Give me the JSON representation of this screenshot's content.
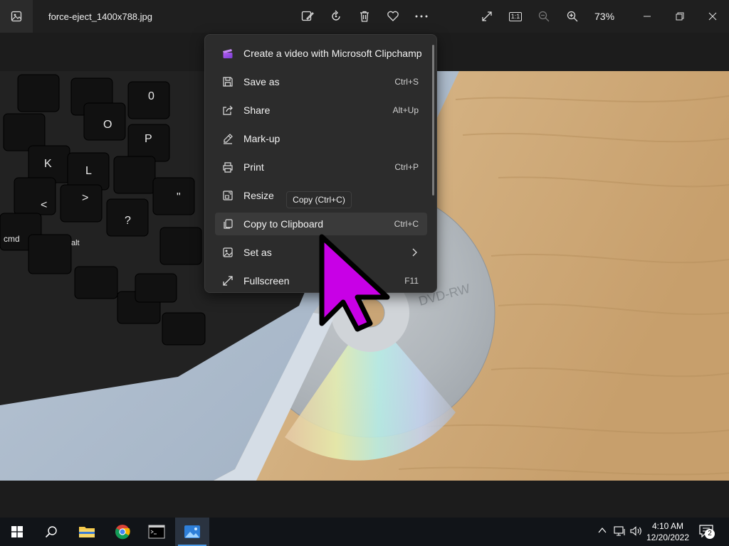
{
  "window": {
    "filename": "force-eject_1400x788.jpg",
    "zoom_level": "73%",
    "toolbar_icons": [
      "edit-image-icon",
      "rotate-icon",
      "delete-icon",
      "favorite-icon",
      "more-icon"
    ],
    "right_icons": [
      "fullscreen-icon",
      "actual-size-icon",
      "zoom-out-icon",
      "zoom-in-icon"
    ],
    "actual_size_label": "1:1"
  },
  "menu": {
    "items": [
      {
        "label": "Create a video with Microsoft Clipchamp",
        "shortcut": "",
        "icon": "clipchamp-icon"
      },
      {
        "label": "Save as",
        "shortcut": "Ctrl+S",
        "icon": "save-icon"
      },
      {
        "label": "Share",
        "shortcut": "Alt+Up",
        "icon": "share-icon"
      },
      {
        "label": "Mark-up",
        "shortcut": "",
        "icon": "markup-icon"
      },
      {
        "label": "Print",
        "shortcut": "Ctrl+P",
        "icon": "print-icon"
      },
      {
        "label": "Resize",
        "shortcut": "",
        "icon": "resize-icon"
      },
      {
        "label": "Copy to Clipboard",
        "shortcut": "Ctrl+C",
        "icon": "copy-icon",
        "highlighted": true
      },
      {
        "label": "Set as",
        "shortcut": "",
        "icon": "set-as-icon",
        "submenu": true
      },
      {
        "label": "Fullscreen",
        "shortcut": "F11",
        "icon": "fullscreen-icon"
      }
    ],
    "tooltip": "Copy (Ctrl+C)"
  },
  "photo": {
    "keys": [
      "0",
      "O",
      "P",
      "L",
      "K",
      "<",
      ">",
      "?",
      "\"",
      "cmd",
      "alt"
    ],
    "disc_text": "DVD-RW"
  },
  "taskbar": {
    "apps": [
      "start-icon",
      "search-icon",
      "file-explorer-icon",
      "chrome-icon",
      "terminal-icon",
      "photos-icon"
    ],
    "time": "4:10 AM",
    "date": "12/20/2022",
    "notification_count": "2"
  },
  "colors": {
    "cursor": "#c800e6",
    "accent": "#4c9be8",
    "menu_bg": "#2c2c2c"
  }
}
